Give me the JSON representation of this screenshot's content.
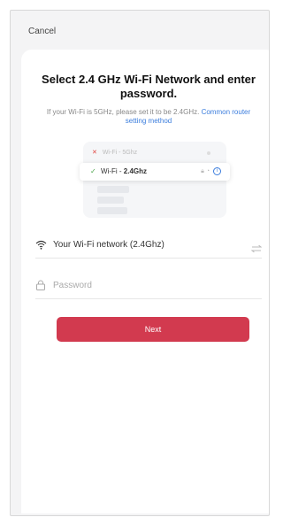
{
  "header": {
    "cancel_label": "Cancel"
  },
  "main": {
    "title": "Select 2.4 GHz Wi-Fi Network and enter password.",
    "subtitle_text": "If your Wi-Fi is 5GHz, please set it to be 2.4GHz.",
    "subtitle_link": "Common router setting method"
  },
  "illustration": {
    "band5_prefix": "Wi-Fi - ",
    "band5_label": "5Ghz",
    "band24_prefix": "Wi-Fi - ",
    "band24_label": "2.4Ghz",
    "info_icon": "info-icon"
  },
  "form": {
    "wifi_label": "Your Wi-Fi network (2.4Ghz)",
    "password_placeholder": "Password",
    "next_label": "Next"
  },
  "colors": {
    "accent": "#d23a4f",
    "link": "#3b7ddd",
    "success": "#4aa44a",
    "error": "#e0443e"
  }
}
